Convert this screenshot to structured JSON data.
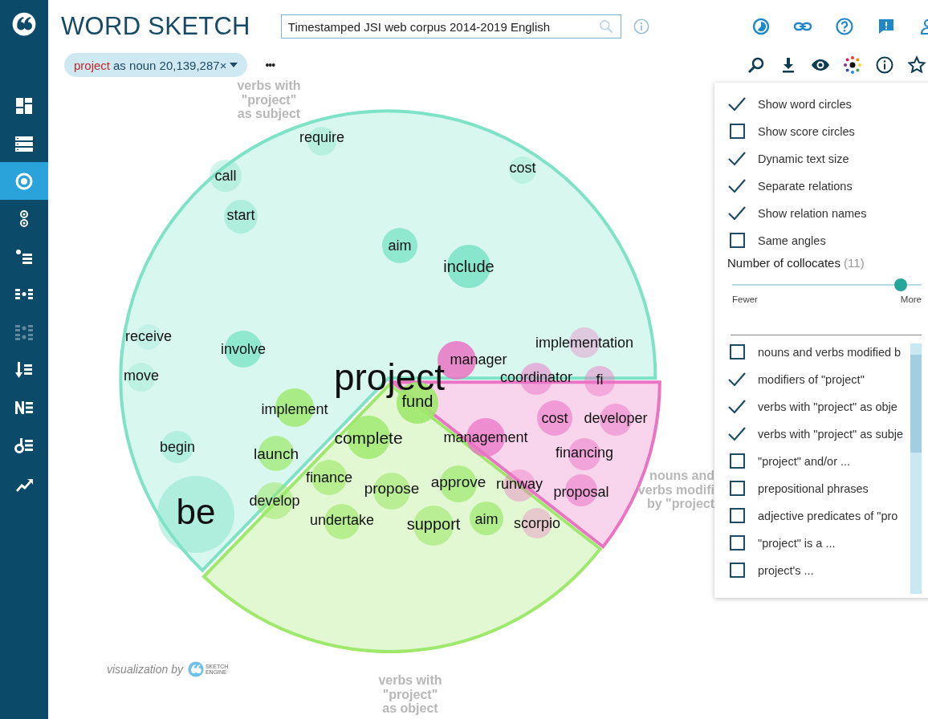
{
  "sidebar": {
    "items": [
      {
        "selected": false,
        "disabled": false
      },
      {
        "selected": false,
        "disabled": false
      },
      {
        "selected": true,
        "disabled": false
      },
      {
        "selected": false,
        "disabled": false
      },
      {
        "selected": false,
        "disabled": false
      },
      {
        "selected": false,
        "disabled": false
      },
      {
        "selected": false,
        "disabled": true
      },
      {
        "selected": false,
        "disabled": false
      },
      {
        "selected": false,
        "disabled": false
      },
      {
        "selected": false,
        "disabled": false
      },
      {
        "selected": false,
        "disabled": false
      }
    ]
  },
  "header": {
    "title": "WORD SKETCH",
    "corpus_search": {
      "value": "Timestamped JSI web corpus 2014-2019 English"
    },
    "query_chip": {
      "lemma": "project",
      "detail": "as noun 20,139,287×"
    },
    "more": "•••"
  },
  "chart": {
    "center_word": "project",
    "relations": [
      {
        "name_lines": [
          "verbs with",
          "\"project\"",
          "as subject"
        ],
        "color": "#7ee3c6",
        "words": [
          "require",
          "cost",
          "call",
          "start",
          "aim",
          "include",
          "receive",
          "involve",
          "move",
          "begin",
          "be"
        ]
      },
      {
        "name_lines": [
          "verbs with",
          "\"project\"",
          "as object"
        ],
        "color": "#9ee86c",
        "words": [
          "fund",
          "implement",
          "complete",
          "launch",
          "finance",
          "propose",
          "approve",
          "develop",
          "undertake",
          "support",
          "aim"
        ]
      },
      {
        "name_lines": [
          "nouns and",
          "verbs modifi",
          "by \"project"
        ],
        "color": "#ea74c4",
        "words": [
          "manager",
          "implementation",
          "coordinator",
          "fi",
          "cost",
          "developer",
          "management",
          "financing",
          "runway",
          "proposal",
          "scorpio"
        ]
      }
    ],
    "credit": "visualization by",
    "logo_text": [
      "SKETCH",
      "ENGINE"
    ]
  },
  "panel": {
    "options": [
      {
        "label": "Show word circles",
        "checked": true
      },
      {
        "label": "Show score circles",
        "checked": false
      },
      {
        "label": "Dynamic text size",
        "checked": true
      },
      {
        "label": "Separate relations",
        "checked": true
      },
      {
        "label": "Show relation names",
        "checked": true
      },
      {
        "label": "Same angles",
        "checked": false
      }
    ],
    "collocates": {
      "label": "Number of collocates",
      "count": "(11)",
      "level": 0.89,
      "min_label": "Fewer",
      "max_label": "More"
    },
    "relations": [
      {
        "label": "nouns and verbs modified b",
        "checked": false
      },
      {
        "label": "modifiers of \"project\"",
        "checked": true
      },
      {
        "label": "verbs with \"project\" as obje",
        "checked": true
      },
      {
        "label": "verbs with \"project\" as subje",
        "checked": true
      },
      {
        "label": "\"project\" and/or ...",
        "checked": false
      },
      {
        "label": "prepositional phrases",
        "checked": false
      },
      {
        "label": "adjective predicates of \"pro",
        "checked": false
      },
      {
        "label": "\"project\" is a ...",
        "checked": false
      },
      {
        "label": "project's ...",
        "checked": false
      }
    ]
  }
}
